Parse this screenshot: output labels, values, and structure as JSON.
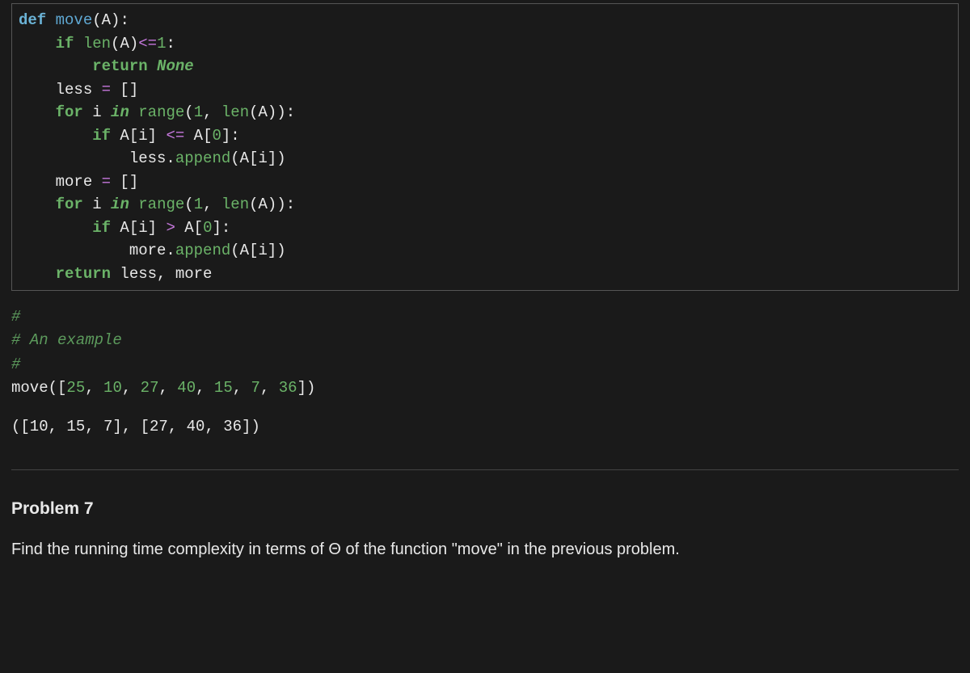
{
  "code1": {
    "l1": {
      "def": "def",
      "name": "move",
      "rest": "(A):"
    },
    "l2": {
      "if": "if",
      "len": "len",
      "a": "(A)",
      "op": "<=",
      "one": "1",
      "colon": ":"
    },
    "l3": {
      "ret": "return",
      "none": "None"
    },
    "l4": {
      "less": "less ",
      "eq": "=",
      "br": " []"
    },
    "l5": {
      "for": "for",
      "i": " i ",
      "in": "in",
      "range": "range",
      "open": "(",
      "one": "1",
      "comma": ", ",
      "len": "len",
      "a": "(A)):"
    },
    "l6": {
      "if": "if",
      "ai": " A[i] ",
      "op": "<=",
      "a0": " A[",
      "zero": "0",
      "close": "]:"
    },
    "l7": {
      "less": "less.",
      "append": "append",
      "rest": "(A[i])"
    },
    "l8": {
      "more": "more ",
      "eq": "=",
      "br": " []"
    },
    "l9": {
      "for": "for",
      "i": " i ",
      "in": "in",
      "range": "range",
      "open": "(",
      "one": "1",
      "comma": ", ",
      "len": "len",
      "a": "(A)):"
    },
    "l10": {
      "if": "if",
      "ai": " A[i] ",
      "op": ">",
      "a0": " A[",
      "zero": "0",
      "close": "]:"
    },
    "l11": {
      "more": "more.",
      "append": "append",
      "rest": "(A[i])"
    },
    "l12": {
      "ret": "return",
      "rest": " less, more"
    }
  },
  "code2": {
    "c1": "#",
    "c2": "# An example",
    "c3": "#",
    "call": {
      "name": "move",
      "open": "([",
      "n1": "25",
      "s1": ", ",
      "n2": "10",
      "s2": ", ",
      "n3": "27",
      "s3": ", ",
      "n4": "40",
      "s4": ", ",
      "n5": "15",
      "s5": ", ",
      "n6": "7",
      "s6": ", ",
      "n7": "36",
      "close": "])"
    }
  },
  "output": "([10, 15, 7], [27, 40, 36])",
  "problem": {
    "heading": "Problem 7",
    "text": "Find the running time complexity in terms of Θ of the function \"move\" in the previous problem."
  }
}
